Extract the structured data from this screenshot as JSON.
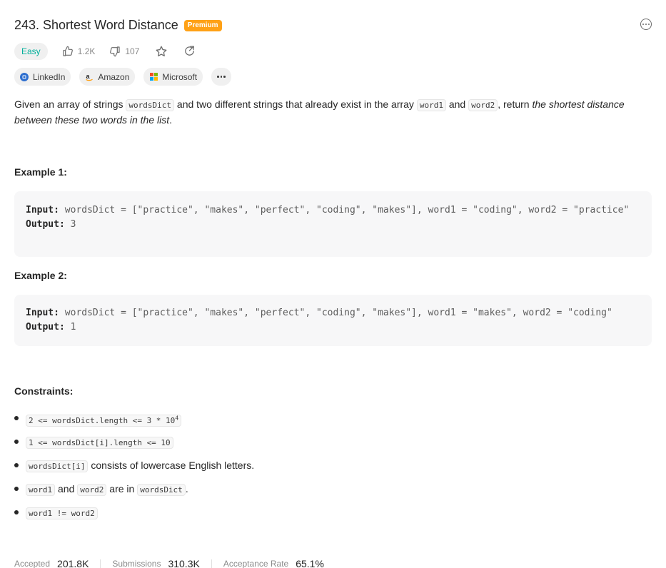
{
  "problem": {
    "title": "243. Shortest Word Distance",
    "premium_label": "Premium",
    "difficulty": "Easy",
    "likes": "1.2K",
    "dislikes": "107"
  },
  "companies": [
    {
      "name": "LinkedIn"
    },
    {
      "name": "Amazon"
    },
    {
      "name": "Microsoft"
    }
  ],
  "description": {
    "p1": "Given an array of strings ",
    "code1": "wordsDict",
    "p2": " and two different strings that already exist in the array ",
    "code2": "word1",
    "p3": " and ",
    "code3": "word2",
    "p4": ", return ",
    "emph": "the shortest distance between these two words in the list",
    "p5": "."
  },
  "examples": [
    {
      "heading": "Example 1:",
      "input_label": "Input:",
      "input": "wordsDict = [\"practice\", \"makes\", \"perfect\", \"coding\", \"makes\"], word1 = \"coding\", word2 = \"practice\"",
      "output_label": "Output:",
      "output": "3"
    },
    {
      "heading": "Example 2:",
      "input_label": "Input:",
      "input": "wordsDict = [\"practice\", \"makes\", \"perfect\", \"coding\", \"makes\"], word1 = \"makes\", word2 = \"coding\"",
      "output_label": "Output:",
      "output": "1"
    }
  ],
  "constraints": {
    "heading": "Constraints:",
    "c1_code": "2 <= wordsDict.length <= 3 * 10",
    "c1_sup": "4",
    "c2_code": "1 <= wordsDict[i].length <= 10",
    "c3_code": "wordsDict[i]",
    "c3_text": " consists of lowercase English letters.",
    "c4_code1": "word1",
    "c4_text1": " and ",
    "c4_code2": "word2",
    "c4_text2": " are in ",
    "c4_code3": "wordsDict",
    "c4_text3": ".",
    "c5_code": "word1 != word2"
  },
  "stats": [
    {
      "label": "Accepted",
      "value": "201.8K"
    },
    {
      "label": "Submissions",
      "value": "310.3K"
    },
    {
      "label": "Acceptance Rate",
      "value": "65.1%"
    }
  ],
  "colors": {
    "easy": "#00af9b",
    "premium": "#ffa116",
    "code_bg": "#f7f7f8"
  }
}
